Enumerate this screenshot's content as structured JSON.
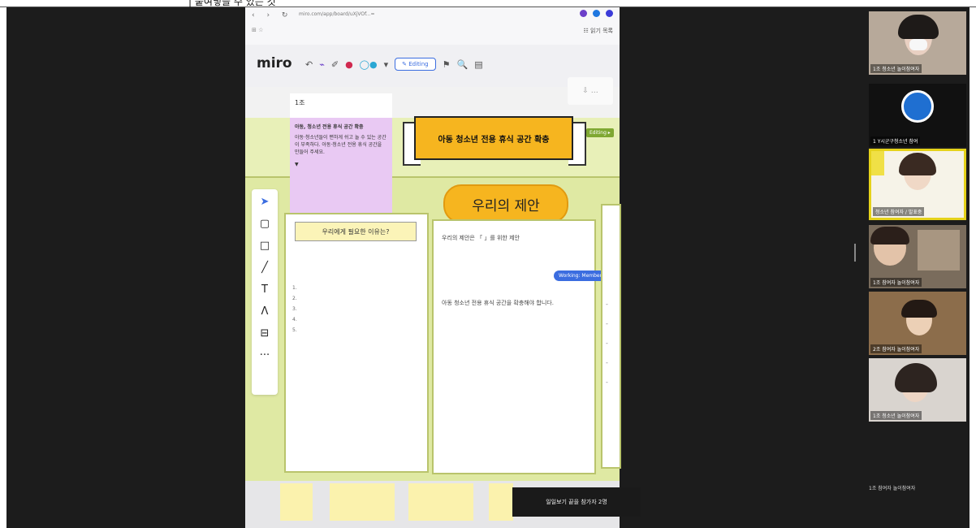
{
  "top_text": "| 붙여넣을 수 있는 것",
  "browser": {
    "nav": "‹ › ↻",
    "url": "miro.com/app/board/uXjVOf...=",
    "row2_left": "⊞ ☆",
    "row2_right": "☷ 읽기 목록"
  },
  "miro": {
    "logo": "miro",
    "editing_label": "✎ Editing",
    "tools": [
      "↶",
      "⌁",
      "✐",
      "●",
      "◯●",
      "▾"
    ],
    "right_icons": [
      "⚑",
      "🔍",
      "▤"
    ],
    "side_panel_icon": "⇩ …"
  },
  "board": {
    "sticky_header": "1조",
    "sticky_title": "아동, 청소년 전용 휴식 공간 확충",
    "sticky_body": "아동·청소년들이 편하게 쉬고 놀 수 있는 공간이 부족하다. 아동·청소년 전용 휴식 공간을 만들어 주세요.",
    "sticky_more": "▼",
    "banner_title": "아동 청소년 전용 휴식 공간 확충",
    "green_chip": "Editing ▸",
    "proposal_title": "우리의 제안",
    "left_card_label": "우리에게 필요한 이유는?",
    "numbers": [
      "1.",
      "2.",
      "3.",
      "4.",
      "5."
    ],
    "mid_card_title": "우리의 제안은 「 」를 위한 제안",
    "mid_card_body": "아동 청소년 전용 휴식 공간을 확충해야 합니다.",
    "blue_chip": "Working: Member",
    "right_dots": [
      "-",
      "-",
      "-",
      "-",
      "-"
    ]
  },
  "toolbar_icons": [
    "cursor-icon",
    "sticky-note-icon",
    "shape-icon",
    "pen-icon",
    "text-icon",
    "connector-icon",
    "frame-icon",
    "more-icon"
  ],
  "toolbar_glyphs": [
    "➤",
    "▢",
    "□",
    "╱",
    "T",
    "Λ",
    "⊟",
    "···"
  ],
  "toast": "일일보기 끝을 참가자 2명",
  "participants": [
    {
      "name": "1조 청소년 놀이참여자"
    },
    {
      "name": "1 Y시군구청소년 참여"
    },
    {
      "name": "청소년 참여자 / 발표중"
    },
    {
      "name": "1조 참여자 놀이참여자"
    },
    {
      "name": "2조 참여자 놀이참여자"
    },
    {
      "name": "1조 청소년 놀이참여자"
    }
  ],
  "last_participant": "1조 참여자 놀이참여자"
}
